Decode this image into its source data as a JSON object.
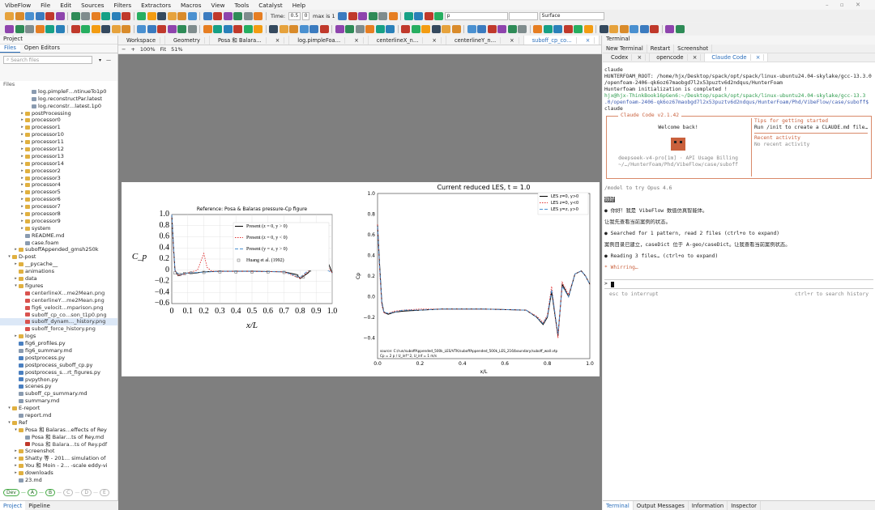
{
  "menu": [
    "VibeFlow",
    "File",
    "Edit",
    "Sources",
    "Filters",
    "Extractors",
    "Macros",
    "View",
    "Tools",
    "Catalyst",
    "Help"
  ],
  "toolbar": {
    "time_label": "Time:",
    "time_value": "0.5",
    "step_value": "0",
    "max_label": "max is 1",
    "array_value": "p",
    "repr_value": "Surface"
  },
  "left": {
    "title": "Project",
    "tabs": [
      "Files",
      "Open Editors"
    ],
    "search_placeholder": "Search files",
    "section": "Files",
    "tree": [
      {
        "t": "log.pimpleF…ntinueTo1p0",
        "d": 4,
        "k": "f"
      },
      {
        "t": "log.reconstructPar.latest",
        "d": 4,
        "k": "f"
      },
      {
        "t": "log.reconstr…latest.1p0",
        "d": 4,
        "k": "f"
      },
      {
        "t": "postProcessing",
        "d": 3,
        "k": "d"
      },
      {
        "t": "processor0",
        "d": 3,
        "k": "d"
      },
      {
        "t": "processor1",
        "d": 3,
        "k": "d"
      },
      {
        "t": "processor10",
        "d": 3,
        "k": "d"
      },
      {
        "t": "processor11",
        "d": 3,
        "k": "d"
      },
      {
        "t": "processor12",
        "d": 3,
        "k": "d"
      },
      {
        "t": "processor13",
        "d": 3,
        "k": "d"
      },
      {
        "t": "processor14",
        "d": 3,
        "k": "d"
      },
      {
        "t": "processor2",
        "d": 3,
        "k": "d"
      },
      {
        "t": "processor3",
        "d": 3,
        "k": "d"
      },
      {
        "t": "processor4",
        "d": 3,
        "k": "d"
      },
      {
        "t": "processor5",
        "d": 3,
        "k": "d"
      },
      {
        "t": "processor6",
        "d": 3,
        "k": "d"
      },
      {
        "t": "processor7",
        "d": 3,
        "k": "d"
      },
      {
        "t": "processor8",
        "d": 3,
        "k": "d"
      },
      {
        "t": "processor9",
        "d": 3,
        "k": "d"
      },
      {
        "t": "system",
        "d": 3,
        "k": "d"
      },
      {
        "t": "README.md",
        "d": 3,
        "k": "f"
      },
      {
        "t": "case.foam",
        "d": 3,
        "k": "f"
      },
      {
        "t": "suboffAppended_gmsh250k",
        "d": 2,
        "k": "d"
      },
      {
        "t": "D-post",
        "d": 1,
        "k": "o"
      },
      {
        "t": "__pycache__",
        "d": 2,
        "k": "d"
      },
      {
        "t": "animations",
        "d": 2,
        "k": "n"
      },
      {
        "t": "data",
        "d": 2,
        "k": "d"
      },
      {
        "t": "figures",
        "d": 2,
        "k": "o"
      },
      {
        "t": "centerlineX…me2Mean.png",
        "d": 3,
        "k": "p"
      },
      {
        "t": "centerlineY…me2Mean.png",
        "d": 3,
        "k": "p"
      },
      {
        "t": "fig6_velocit…mparison.png",
        "d": 3,
        "k": "p"
      },
      {
        "t": "suboff_cp_co…son_t1p0.png",
        "d": 3,
        "k": "p"
      },
      {
        "t": "suboff_dynam…_history.png",
        "d": 3,
        "k": "s"
      },
      {
        "t": "suboff_force_history.png",
        "d": 3,
        "k": "p"
      },
      {
        "t": "logs",
        "d": 2,
        "k": "d"
      },
      {
        "t": "fig6_profiles.py",
        "d": 2,
        "k": "y"
      },
      {
        "t": "fig6_summary.md",
        "d": 2,
        "k": "f"
      },
      {
        "t": "postprocess.py",
        "d": 2,
        "k": "y"
      },
      {
        "t": "postprocess_suboff_cp.py",
        "d": 2,
        "k": "y"
      },
      {
        "t": "postprocess_s…rt_figures.py",
        "d": 2,
        "k": "y"
      },
      {
        "t": "pvpython.py",
        "d": 2,
        "k": "y"
      },
      {
        "t": "scenes.py",
        "d": 2,
        "k": "y"
      },
      {
        "t": "suboff_cp_summary.md",
        "d": 2,
        "k": "f"
      },
      {
        "t": "summary.md",
        "d": 2,
        "k": "f"
      },
      {
        "t": "E-report",
        "d": 1,
        "k": "o"
      },
      {
        "t": "report.md",
        "d": 2,
        "k": "f"
      },
      {
        "t": "Ref",
        "d": 1,
        "k": "o"
      },
      {
        "t": "Posa 和 Balaras…effects of Rey",
        "d": 2,
        "k": "o"
      },
      {
        "t": "Posa 和 Balar…ts of Rey.md",
        "d": 3,
        "k": "f"
      },
      {
        "t": "Posa 和 Balara…ts of Rey.pdf",
        "d": 3,
        "k": "r"
      },
      {
        "t": "Screenshot",
        "d": 2,
        "k": "d"
      },
      {
        "t": "Shatty 等 - 201… simulation of",
        "d": 2,
        "k": "d"
      },
      {
        "t": "You 和 Moin - 2… -scale eddy-vi",
        "d": 2,
        "k": "d"
      },
      {
        "t": "downloads",
        "d": 2,
        "k": "d"
      },
      {
        "t": "23.md",
        "d": 2,
        "k": "f"
      }
    ],
    "dev": [
      "Dev",
      "A",
      "B",
      "C",
      "D",
      "E"
    ],
    "bottom_tabs": [
      "Project",
      "Pipeline"
    ]
  },
  "center": {
    "tabs": [
      "Workspace",
      "Geometry",
      "Posa 和 Balara…",
      "log.pimpleFoa…",
      "centerlineX_n…",
      "centerlineY_n…",
      "suboff_cp_co…"
    ],
    "zoom": "100%",
    "fit": "Fit",
    "fit_pct": "51%"
  },
  "chart_data": [
    {
      "type": "line",
      "title": "Reference: Posa & Balaras pressure-Cp figure",
      "xlabel": "x/L",
      "ylabel": "C_p",
      "xlim": [
        0,
        1.0
      ],
      "ylim": [
        -0.6,
        1.0
      ],
      "xticks": [
        "0",
        "0.1",
        "0.2",
        "0.3",
        "0.4",
        "0.5",
        "0.6",
        "0.7",
        "0.8",
        "0.9",
        "1.0"
      ],
      "yticks": [
        "1.0",
        "0.8",
        "0.6",
        "0.4",
        "0.2",
        "0",
        "−0.2",
        "−0.4",
        "−0.6"
      ],
      "legend": [
        "Present (z = 0, y > 0)",
        "Present (z = 0, y < 0)",
        "Present (y = z, y > 0)",
        "Huang et al. (1992)"
      ],
      "series": [
        {
          "name": "Present (z = 0, y > 0)",
          "color": "#000000",
          "x": [
            0,
            0.01,
            0.02,
            0.04,
            0.06,
            0.1,
            0.15,
            0.2,
            0.3,
            0.5,
            0.7,
            0.78,
            0.8,
            0.85,
            0.88,
            0.9,
            0.95,
            0.98,
            1.0
          ],
          "y": [
            1.0,
            0.45,
            0.0,
            -0.1,
            -0.07,
            -0.05,
            -0.05,
            -0.03,
            -0.02,
            -0.02,
            -0.03,
            -0.08,
            -0.15,
            -0.05,
            0.05,
            0.12,
            0.13,
            0.1,
            -0.05
          ]
        },
        {
          "name": "Present (z = 0, y < 0)",
          "color": "#e03030",
          "x": [
            0,
            0.01,
            0.02,
            0.04,
            0.1,
            0.16,
            0.18,
            0.2,
            0.22,
            0.25,
            0.3,
            0.5,
            0.7,
            0.8,
            0.88,
            0.9,
            0.95,
            1.0
          ],
          "y": [
            1.0,
            0.4,
            0.0,
            -0.1,
            -0.05,
            0.0,
            0.15,
            0.3,
            0.05,
            -0.02,
            -0.02,
            -0.02,
            -0.03,
            -0.15,
            0.05,
            0.12,
            0.15,
            -0.05
          ]
        },
        {
          "name": "Present (y = z, y > 0)",
          "color": "#4a90d0",
          "x": [
            0,
            0.02,
            0.05,
            0.1,
            0.3,
            0.5,
            0.7,
            0.8,
            0.9,
            1.0
          ],
          "y": [
            1.0,
            -0.02,
            -0.08,
            -0.05,
            -0.02,
            -0.02,
            -0.03,
            -0.13,
            0.12,
            -0.05
          ]
        },
        {
          "name": "Huang et al. (1992)",
          "color": "#777777",
          "x": [
            0.02,
            0.05,
            0.08,
            0.12,
            0.2,
            0.3,
            0.4,
            0.5,
            0.6,
            0.7,
            0.78,
            0.82,
            0.86,
            0.9,
            0.94,
            0.97
          ],
          "y": [
            -0.05,
            -0.08,
            -0.06,
            -0.05,
            -0.04,
            -0.03,
            -0.03,
            -0.03,
            -0.03,
            -0.04,
            -0.1,
            -0.12,
            0.0,
            0.15,
            0.15,
            0.12
          ]
        }
      ]
    },
    {
      "type": "line",
      "title": "Current reduced LES, t = 1.0",
      "xlabel": "x/L",
      "ylabel": "Cp",
      "xlim": [
        0.0,
        1.0
      ],
      "ylim": [
        -0.6,
        1.0
      ],
      "xticks": [
        "0.0",
        "0.2",
        "0.4",
        "0.6",
        "0.8",
        "1.0"
      ],
      "yticks": [
        "1.0",
        "0.8",
        "0.6",
        "0.4",
        "0.2",
        "0.0",
        "−0.2",
        "−0.4"
      ],
      "legend": [
        "LES z=0, y>0",
        "LES z=0, y<0",
        "LES y=z, y>0"
      ],
      "note": [
        "source: C:/run/suboffAppended_500k_LES/VTK/suboffAppended_500k_LES_216/boundary/suboff_wall.vtp",
        "Cp = 2 p / U_inf^2, U_inf = 1 m/s"
      ],
      "series": [
        {
          "name": "LES z=0, y>0",
          "color": "#000000",
          "x": [
            0,
            0.01,
            0.02,
            0.03,
            0.05,
            0.08,
            0.12,
            0.2,
            0.3,
            0.5,
            0.7,
            0.75,
            0.78,
            0.8,
            0.82,
            0.85,
            0.87,
            0.9,
            0.93,
            0.96,
            0.98,
            1.0
          ],
          "y": [
            0.7,
            0.3,
            -0.05,
            -0.15,
            -0.17,
            -0.15,
            -0.14,
            -0.13,
            -0.12,
            -0.12,
            -0.13,
            -0.2,
            -0.27,
            -0.2,
            0.05,
            -0.38,
            0.12,
            0.0,
            0.22,
            0.25,
            0.2,
            0.12
          ]
        },
        {
          "name": "LES z=0, y<0",
          "color": "#e03030",
          "x": [
            0,
            0.01,
            0.02,
            0.03,
            0.05,
            0.08,
            0.12,
            0.2,
            0.3,
            0.5,
            0.7,
            0.75,
            0.78,
            0.8,
            0.82,
            0.85,
            0.87,
            0.9,
            0.93,
            0.96,
            0.98,
            1.0
          ],
          "y": [
            0.7,
            0.25,
            -0.08,
            -0.16,
            -0.16,
            -0.14,
            -0.13,
            -0.12,
            -0.12,
            -0.12,
            -0.13,
            -0.19,
            -0.25,
            -0.18,
            0.1,
            -0.4,
            0.14,
            0.02,
            0.22,
            0.25,
            0.2,
            0.12
          ]
        },
        {
          "name": "LES y=z, y>0",
          "color": "#4a90d0",
          "x": [
            0,
            0.01,
            0.02,
            0.03,
            0.05,
            0.08,
            0.12,
            0.2,
            0.3,
            0.5,
            0.7,
            0.75,
            0.78,
            0.8,
            0.82,
            0.85,
            0.87,
            0.9,
            0.93,
            0.96,
            0.98,
            1.0
          ],
          "y": [
            0.68,
            0.28,
            -0.06,
            -0.15,
            -0.16,
            -0.15,
            -0.13,
            -0.13,
            -0.12,
            -0.12,
            -0.13,
            -0.2,
            -0.26,
            -0.19,
            0.07,
            -0.36,
            0.1,
            0.0,
            0.22,
            0.25,
            0.2,
            0.12
          ]
        }
      ]
    }
  ],
  "right": {
    "title": "Terminal",
    "actions": [
      "New Terminal",
      "Restart",
      "Screenshot"
    ],
    "tabs": [
      "Codex",
      "opencode",
      "Claude Code"
    ],
    "lines": [
      {
        "t": "claude",
        "c": "#222"
      },
      {
        "t": "HUNTERFOAM_ROOT: /home/hjx/Desktop/spack/opt/spack/linux-ubuntu24.04-skylake/gcc-13.3.0",
        "c": "#222"
      },
      {
        "t": "/openfoam-2406-qk6oz67maobgd7l2x53puztv6d2ndqus/HunterFoam",
        "c": "#222"
      },
      {
        "t": "Hunterfoam initialization is completed !",
        "c": "#222"
      },
      {
        "t": "hjx@hjx-ThinkBook16pGen6:~/Desktop/spack/opt/spack/linux-ubuntu24.04-skylake/gcc-13.3",
        "c": "#2a9a4a"
      },
      {
        "t": ".0/openfoam-2406-qk6oz67maobgd7l2x53puztv6d2ndqus/HunterFoam/Phd/VibeFlow/case/suboff$",
        "c": "#3a5ab0"
      },
      {
        "t": "claude",
        "c": "#222"
      }
    ],
    "claude": {
      "box_title": "Claude Code v2.1.42",
      "welcome": "Welcome back!",
      "model_line": "deepseek-v4-pro[1m] · API Usage Billing",
      "path_line": "~/…/HunterFoam/Phd/VibeFlow/case/suboff",
      "tips_title": "Tips for getting started",
      "tips": "Run /init to create a CLAUDE.md file…",
      "recent_title": "Recent activity",
      "recent": "No recent activity"
    },
    "after": [
      {
        "t": "/model to try Opus 4.6",
        "c": "#777"
      },
      {
        "t": " 你好 ",
        "c": "#fff",
        "bg": "#555"
      },
      {
        "t": "● 你好！我是 VibeFlow 数值仿真智能体。",
        "c": "#222"
      },
      {
        "t": "  让我先查看当前案例的状态。",
        "c": "#222"
      },
      {
        "t": "● Searched for 1 pattern, read 2 files (ctrl+o to expand)",
        "c": "#222"
      },
      {
        "t": "  案例目录已建立，caseDict 位于 A-geo/caseDict。让我查看当前案例状态。",
        "c": "#222"
      },
      {
        "t": "● Reading 3 files… (ctrl+o to expand)",
        "c": "#222"
      },
      {
        "t": "* Whirring…",
        "c": "#c9603c"
      }
    ],
    "prompt": ">",
    "hint_left": "esc to interrupt",
    "hint_right": "ctrl+r to search history",
    "bottom_tabs": [
      "Terminal",
      "Output Messages",
      "Information",
      "Inspector"
    ]
  }
}
